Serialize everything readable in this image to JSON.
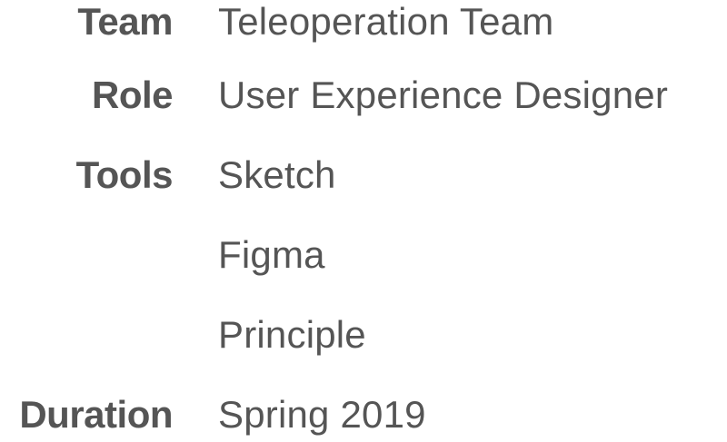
{
  "details": {
    "team": {
      "label": "Team",
      "value": "Teleoperation Team"
    },
    "role": {
      "label": "Role",
      "value": "User Experience Designer"
    },
    "tools": {
      "label": "Tools",
      "values": [
        "Sketch",
        "Figma",
        "Principle"
      ]
    },
    "duration": {
      "label": "Duration",
      "value": "Spring 2019"
    }
  }
}
